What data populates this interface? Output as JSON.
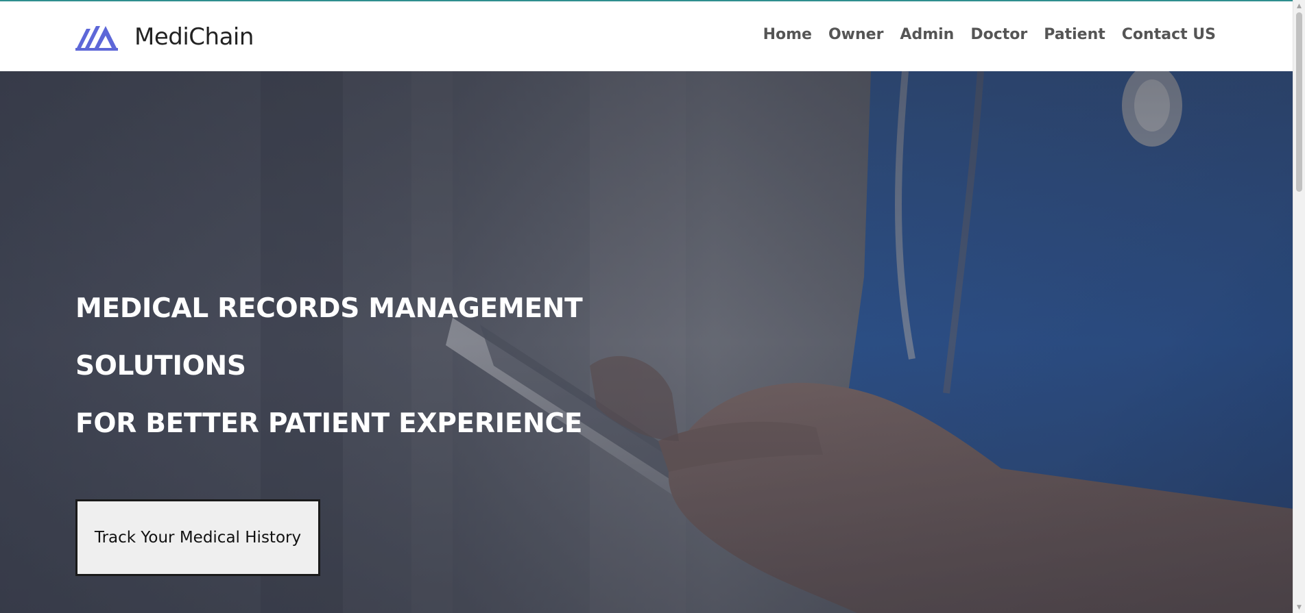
{
  "brand": {
    "name": "MediChain",
    "logo_icon": "mountain-peaks-logo-icon",
    "logo_color": "#5d67d8"
  },
  "nav": {
    "items": [
      {
        "label": "Home"
      },
      {
        "label": "Owner"
      },
      {
        "label": "Admin"
      },
      {
        "label": "Doctor"
      },
      {
        "label": "Patient"
      },
      {
        "label": "Contact US"
      }
    ]
  },
  "hero": {
    "lines": [
      "MEDICAL RECORDS MANAGEMENT",
      "SOLUTIONS",
      "FOR BETTER PATIENT EXPERIENCE"
    ],
    "cta_label": "Track Your Medical History",
    "background_image": "doctor-using-tablet-photo"
  },
  "colors": {
    "accent": "#5d67d8",
    "nav_text": "#555555",
    "scrub_blue": "#2f61a8"
  }
}
